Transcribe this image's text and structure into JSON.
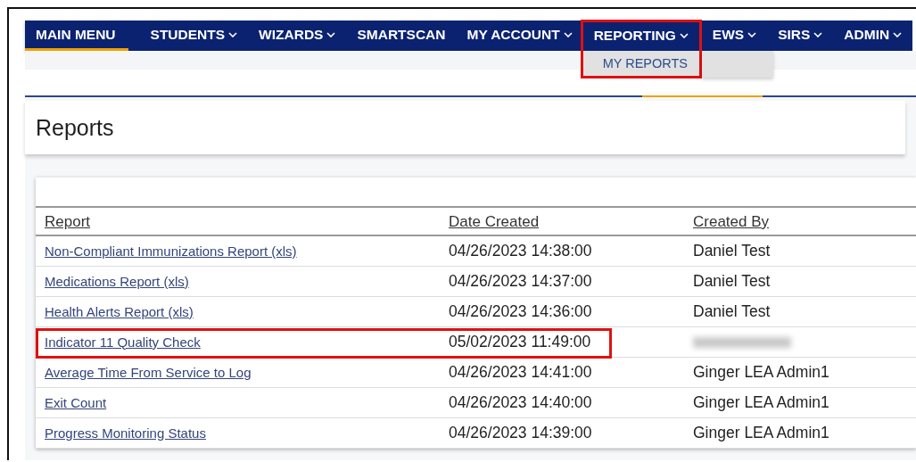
{
  "nav": [
    {
      "label": "MAIN MENU",
      "dropdown": false,
      "selected": true,
      "highlighted": false
    },
    {
      "label": "STUDENTS",
      "dropdown": true,
      "selected": false,
      "highlighted": false
    },
    {
      "label": "WIZARDS",
      "dropdown": true,
      "selected": false,
      "highlighted": false
    },
    {
      "label": "SMARTSCAN",
      "dropdown": false,
      "selected": false,
      "highlighted": false
    },
    {
      "label": "MY ACCOUNT",
      "dropdown": true,
      "selected": false,
      "highlighted": false
    },
    {
      "label": "REPORTING",
      "dropdown": true,
      "selected": false,
      "highlighted": true,
      "menu": [
        "MY REPORTS"
      ]
    },
    {
      "label": "EWS",
      "dropdown": true,
      "selected": false,
      "highlighted": false
    },
    {
      "label": "SIRS",
      "dropdown": true,
      "selected": false,
      "highlighted": false
    },
    {
      "label": "ADMIN",
      "dropdown": true,
      "selected": false,
      "highlighted": false
    }
  ],
  "page_title": "Reports",
  "table": {
    "columns": [
      "Report",
      "Date Created",
      "Created By"
    ],
    "rows": [
      {
        "report": "Non-Compliant Immunizations Report (xls)",
        "date_created": "04/26/2023 14:38:00",
        "created_by": "Daniel Test",
        "highlighted": false
      },
      {
        "report": "Medications Report (xls)",
        "date_created": "04/26/2023 14:37:00",
        "created_by": "Daniel Test",
        "highlighted": false
      },
      {
        "report": "Health Alerts Report (xls)",
        "date_created": "04/26/2023 14:36:00",
        "created_by": "Daniel Test",
        "highlighted": false
      },
      {
        "report": "Indicator 11 Quality Check",
        "date_created": "05/02/2023 11:49:00",
        "created_by_redacted": true,
        "highlighted": true
      },
      {
        "report": "Average Time From Service to Log",
        "date_created": "04/26/2023 14:41:00",
        "created_by": "Ginger LEA Admin1",
        "highlighted": false
      },
      {
        "report": "Exit Count",
        "date_created": "04/26/2023 14:40:00",
        "created_by": "Ginger LEA Admin1",
        "highlighted": false
      },
      {
        "report": "Progress Monitoring Status",
        "date_created": "04/26/2023 14:39:00",
        "created_by": "Ginger LEA Admin1",
        "highlighted": false
      }
    ]
  }
}
